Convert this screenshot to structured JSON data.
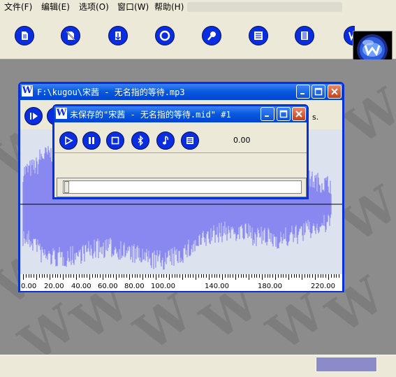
{
  "menu": {
    "items": [
      {
        "label": "文件(F)"
      },
      {
        "label": "编辑(E)"
      },
      {
        "label": "选项(O)"
      },
      {
        "label": "窗口(W)"
      },
      {
        "label": "帮助(H)"
      }
    ]
  },
  "toolbar": {
    "buttons": [
      {
        "icon": "new-document-icon"
      },
      {
        "icon": "no-document-icon"
      },
      {
        "icon": "import-icon"
      },
      {
        "icon": "circle-icon"
      },
      {
        "icon": "microphone-icon"
      },
      {
        "icon": "list-icon"
      },
      {
        "icon": "columns-icon"
      },
      {
        "icon": "w-icon"
      }
    ],
    "accent_color": "#0a2ddf"
  },
  "audio_window": {
    "title": "F:\\kugou\\宋茜 - 无名指的等待.mp3",
    "icon_letter": "W",
    "time_suffix": "s.",
    "axis_labels": [
      "0.00",
      "20.00",
      "40.00",
      "60.00",
      "80.00",
      "100.00",
      "140.00",
      "180.00",
      "220.00"
    ],
    "waveform_color": "#8888f0"
  },
  "midi_window": {
    "title": "未保存的\"宋茜 - 无名指的等待.mid\" #1",
    "icon_letter": "W",
    "time_value": "0.00",
    "seek_fraction": 0.0,
    "buttons": [
      {
        "icon": "play-icon"
      },
      {
        "icon": "pause-icon"
      },
      {
        "icon": "stop-icon"
      },
      {
        "icon": "bluetooth-icon"
      },
      {
        "icon": "music-note-icon"
      },
      {
        "icon": "list-icon"
      }
    ]
  },
  "colors": {
    "titlebar": "#0a5bdc",
    "workspace": "#8c8c8c",
    "status_progress": "#8b8bc9"
  }
}
